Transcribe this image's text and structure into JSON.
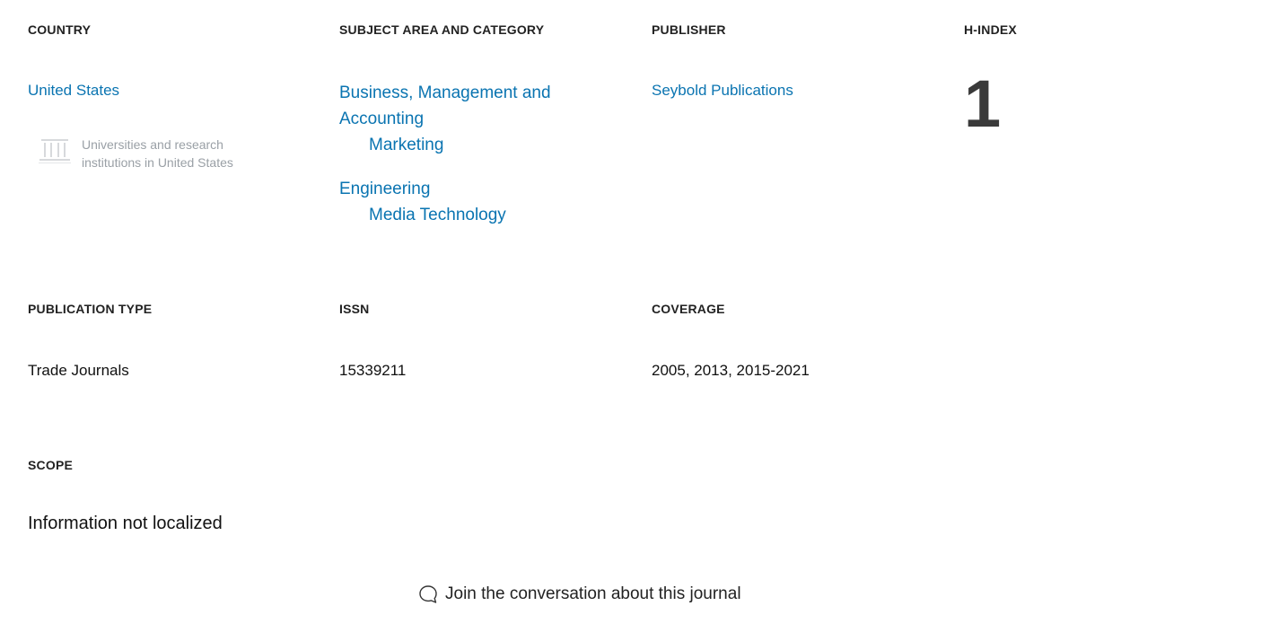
{
  "headers": {
    "country": "COUNTRY",
    "subject": "SUBJECT AREA AND CATEGORY",
    "publisher": "PUBLISHER",
    "hindex": "H-INDEX",
    "pubtype": "PUBLICATION TYPE",
    "issn": "ISSN",
    "coverage": "COVERAGE",
    "scope": "SCOPE"
  },
  "country": {
    "name": "United States",
    "universities_text": "Universities and research institutions in United States",
    "icon": "university-icon"
  },
  "subject": {
    "groups": [
      {
        "area": "Business, Management and Accounting",
        "category": "Marketing"
      },
      {
        "area": "Engineering",
        "category": "Media Technology"
      }
    ]
  },
  "publisher": "Seybold Publications",
  "hindex": "1",
  "pubtype": "Trade Journals",
  "issn": "15339211",
  "coverage": "2005, 2013, 2015-2021",
  "scope": "Information not localized",
  "join": {
    "label": "Join the conversation about this journal",
    "icon": "speech-bubble-icon"
  },
  "colors": {
    "link": "#0a74b1",
    "muted": "#9aa0a6",
    "hindex": "#3a3a3a"
  }
}
